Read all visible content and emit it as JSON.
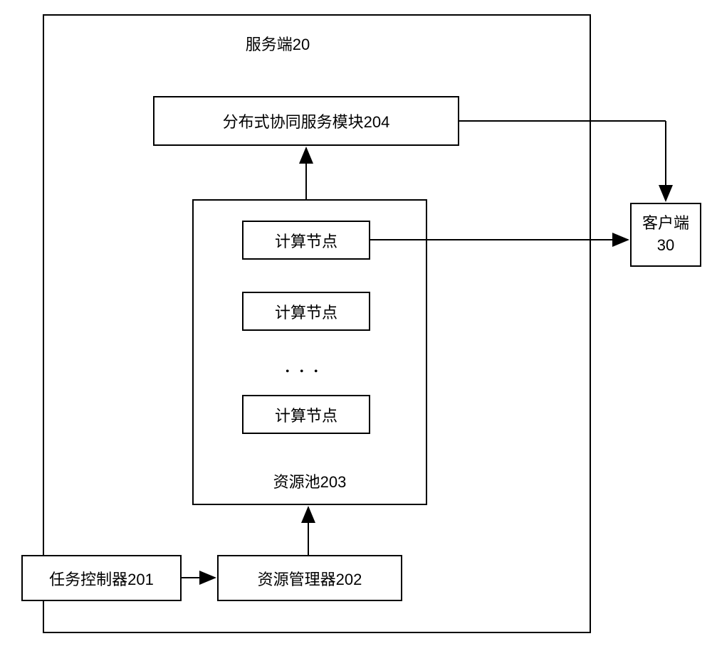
{
  "server": {
    "title": "服务端20",
    "dist_module": "分布式协同服务模块204",
    "resource_pool": {
      "label": "资源池203",
      "node_label": "计算节点",
      "ellipsis": "．．．"
    },
    "task_controller": "任务控制器201",
    "resource_manager": "资源管理器202"
  },
  "client": {
    "label": "客户端",
    "number": "30"
  }
}
